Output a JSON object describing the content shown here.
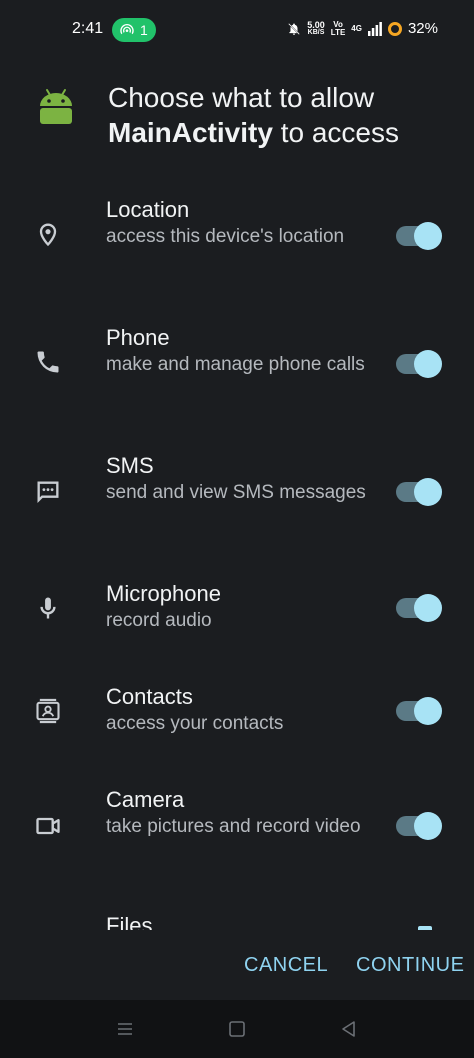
{
  "status": {
    "time": "2:41",
    "hotspot_count": "1",
    "speed_value": "5.00",
    "speed_unit": "KB/S",
    "volte_top": "Vo",
    "volte_bottom": "LTE",
    "network": "4G",
    "battery": "32%"
  },
  "header": {
    "title_prefix": "Choose what to allow",
    "app_name": "MainActivity",
    "title_suffix": "to access"
  },
  "permissions": [
    {
      "title": "Location",
      "description": "access this device's location",
      "icon": "location-pin-icon",
      "enabled": true
    },
    {
      "title": "Phone",
      "description": "make and manage phone calls",
      "icon": "phone-icon",
      "enabled": true
    },
    {
      "title": "SMS",
      "description": "send and view SMS messages",
      "icon": "sms-icon",
      "enabled": true
    },
    {
      "title": "Microphone",
      "description": "record audio",
      "icon": "microphone-icon",
      "enabled": true
    },
    {
      "title": "Contacts",
      "description": "access your contacts",
      "icon": "contacts-icon",
      "enabled": true
    },
    {
      "title": "Camera",
      "description": "take pictures and record video",
      "icon": "camera-icon",
      "enabled": true
    }
  ],
  "partial_item": {
    "title": "Files"
  },
  "actions": {
    "cancel_label": "CANCEL",
    "continue_label": "CONTINUE"
  },
  "colors": {
    "background": "#1b1d20",
    "accent": "#8fd3f0",
    "toggle_knob": "#a8e3f5",
    "toggle_track": "#5b7a86",
    "android_green": "#7cb342"
  }
}
